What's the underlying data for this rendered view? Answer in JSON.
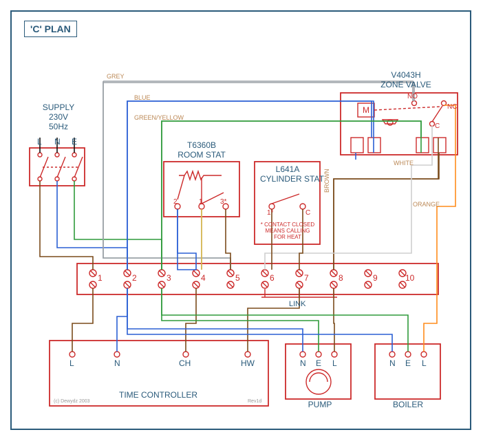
{
  "title": "'C' PLAN",
  "supply": {
    "label": "SUPPLY",
    "voltage": "230V",
    "freq": "50Hz",
    "l": "L",
    "n": "N",
    "e": "E"
  },
  "zone_valve": {
    "model": "V4043H",
    "name": "ZONE VALVE",
    "m": "M",
    "no": "NO",
    "nc": "NC",
    "c": "C"
  },
  "room_stat": {
    "model": "T6360B",
    "name": "ROOM STAT",
    "t1": "1",
    "t2": "2",
    "t3": "3*"
  },
  "cyl_stat": {
    "model": "L641A",
    "name": "CYLINDER STAT",
    "t1": "1*",
    "c": "C",
    "note1": "* CONTACT CLOSED",
    "note2": "MEANS CALLING",
    "note3": "FOR HEAT"
  },
  "junction": {
    "t1": "1",
    "t2": "2",
    "t3": "3",
    "t4": "4",
    "t5": "5",
    "t6": "6",
    "t7": "7",
    "t8": "8",
    "t9": "9",
    "t10": "10",
    "link": "LINK"
  },
  "time_ctrl": {
    "name": "TIME CONTROLLER",
    "l": "L",
    "n": "N",
    "ch": "CH",
    "hw": "HW"
  },
  "pump": {
    "name": "PUMP",
    "n": "N",
    "e": "E",
    "l": "L"
  },
  "boiler": {
    "name": "BOILER",
    "n": "N",
    "e": "E",
    "l": "L"
  },
  "wires": {
    "grey": "GREY",
    "blue": "BLUE",
    "gy": "GREEN/YELLOW",
    "brown": "BROWN",
    "white": "WHITE",
    "orange": "ORANGE"
  },
  "credit": "(c) Dewydz 2003",
  "rev": "Rev1d",
  "colors": {
    "box": "#cc2a2a",
    "text": "#2a5a7a",
    "grey": "#9aa0a6",
    "blue": "#2a5fd4",
    "gy": "#2e9a3a",
    "brown": "#7a4a1a",
    "white": "#bdbdbd",
    "orange": "#ff8c1a",
    "black": "#111"
  }
}
